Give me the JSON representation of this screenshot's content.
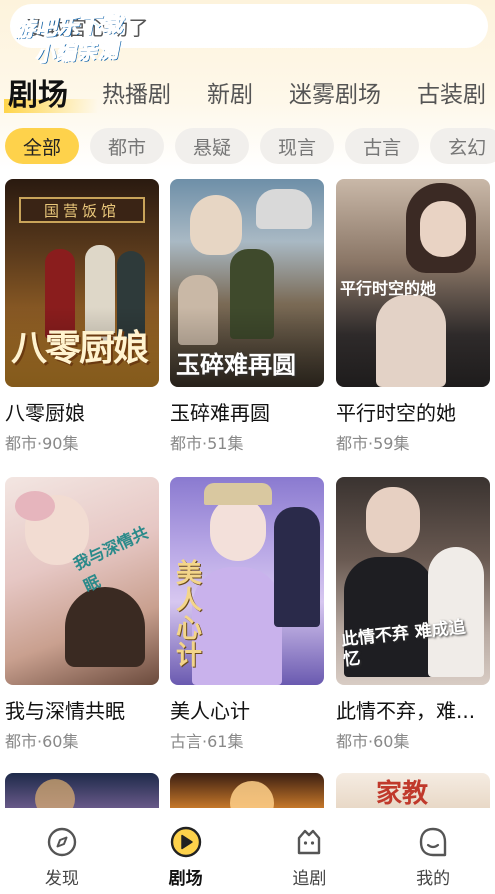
{
  "search": {
    "text": "要教官心动了"
  },
  "watermark": {
    "line1": "游吧乐下载",
    "line2": "小编亲测"
  },
  "main_tabs": [
    {
      "label": "剧场",
      "active": true
    },
    {
      "label": "热播剧",
      "active": false
    },
    {
      "label": "新剧",
      "active": false
    },
    {
      "label": "迷雾剧场",
      "active": false
    },
    {
      "label": "古装剧",
      "active": false
    }
  ],
  "filters": [
    {
      "label": "全部",
      "active": true
    },
    {
      "label": "都市",
      "active": false
    },
    {
      "label": "悬疑",
      "active": false
    },
    {
      "label": "现言",
      "active": false
    },
    {
      "label": "古言",
      "active": false
    },
    {
      "label": "玄幻",
      "active": false
    }
  ],
  "dramas": [
    {
      "title": "八零厨娘",
      "meta": "都市·90集",
      "poster_text": "八零厨娘",
      "poster_sign": "国营饭馆"
    },
    {
      "title": "玉碎难再圆",
      "meta": "都市·51集",
      "poster_text": "玉碎难再圆"
    },
    {
      "title": "平行时空的她",
      "meta": "都市·59集",
      "poster_text": "平行时空的她"
    },
    {
      "title": "我与深情共眠",
      "meta": "都市·60集",
      "poster_text": "我与深情共眠"
    },
    {
      "title": "美人心计",
      "meta": "古言·61集",
      "poster_text": "美人心计"
    },
    {
      "title": "此情不弃，难...",
      "meta": "都市·60集",
      "poster_text": "此情不弃 难成追忆"
    }
  ],
  "partial_posters": [
    {
      "poster_text": "家教"
    }
  ],
  "bottom_nav": [
    {
      "label": "发现",
      "icon": "compass-icon",
      "active": false
    },
    {
      "label": "剧场",
      "icon": "play-icon",
      "active": true
    },
    {
      "label": "追剧",
      "icon": "bookmark-face-icon",
      "active": false
    },
    {
      "label": "我的",
      "icon": "profile-icon",
      "active": false
    }
  ],
  "colors": {
    "accent": "#fed24b",
    "chip_bg": "#f1efec",
    "top_bg": "#fdf3dc"
  }
}
